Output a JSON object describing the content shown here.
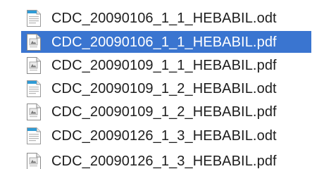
{
  "files": [
    {
      "name": "CDC_20090106_1_1_HEBABIL.odt",
      "icon": "odt-document-icon",
      "selected": false
    },
    {
      "name": "CDC_20090106_1_1_HEBABIL.pdf",
      "icon": "pdf-document-icon",
      "selected": true
    },
    {
      "name": "CDC_20090109_1_1_HEBABIL.pdf",
      "icon": "pdf-document-icon",
      "selected": false
    },
    {
      "name": "CDC_20090109_1_2_HEBABIL.odt",
      "icon": "odt-document-icon",
      "selected": false
    },
    {
      "name": "CDC_20090109_1_2_HEBABIL.pdf",
      "icon": "pdf-document-icon",
      "selected": false
    },
    {
      "name": "CDC_20090126_1_3_HEBABIL.odt",
      "icon": "odt-document-icon",
      "selected": false
    },
    {
      "name": "CDC_20090126_1_3_HEBABIL.pdf",
      "icon": "pdf-document-icon",
      "selected": false
    }
  ],
  "colors": {
    "selection": "#3a75d0",
    "odt_band": "#2e9bd6",
    "text": "#1e1e1e"
  }
}
